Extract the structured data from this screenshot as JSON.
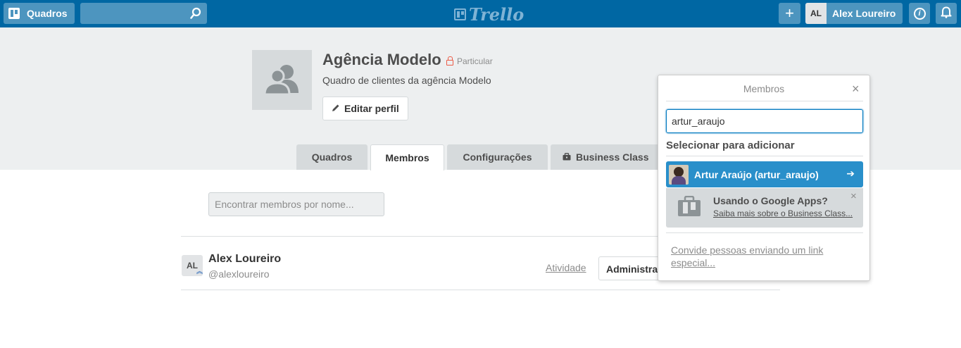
{
  "topbar": {
    "boards_label": "Quadros",
    "search_value": "",
    "logo_text": "Trello",
    "add_label": "+",
    "user_initials": "AL",
    "user_name": "Alex Loureiro",
    "info_label": "i"
  },
  "board": {
    "title": "Agência Modelo",
    "privacy": "Particular",
    "description": "Quadro de clientes da agência Modelo",
    "edit_label": "Editar perfil"
  },
  "tabs": [
    {
      "label": "Quadros",
      "active": false
    },
    {
      "label": "Membros",
      "active": true
    },
    {
      "label": "Configurações",
      "active": false
    },
    {
      "label": "Business Class",
      "active": false
    }
  ],
  "members": {
    "search_placeholder": "Encontrar membros por nome...",
    "list": [
      {
        "initials": "AL",
        "name": "Alex Loureiro",
        "username": "@alexloureiro",
        "activity_label": "Atividade",
        "role_label": "Administrador"
      }
    ]
  },
  "popover": {
    "title": "Membros",
    "close_label": "×",
    "search_value": "artur_araujo",
    "section_label": "Selecionar para adicionar",
    "result": {
      "name": "Artur Araújo (artur_araujo)",
      "arrow": "➔"
    },
    "promo": {
      "title": "Usando o Google Apps?",
      "link": "Saiba mais sobre o Business Class...",
      "close_label": "×"
    },
    "invite_link": "Convide pessoas enviando um link especial..."
  },
  "colors": {
    "topbar": "#0067a3",
    "topbar_button": "#4d95bf",
    "result_highlight": "#298fca",
    "privacy_lock": "#eb5a46"
  }
}
